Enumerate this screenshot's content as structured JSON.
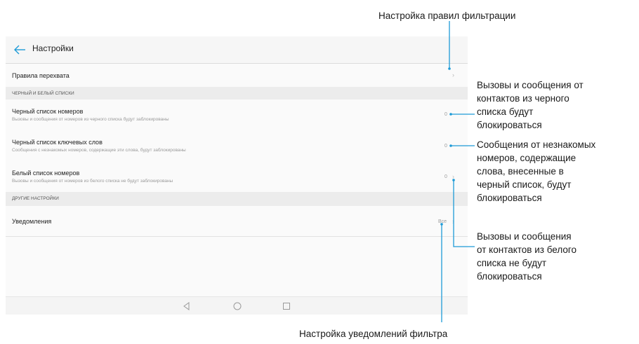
{
  "callouts": {
    "filter_rules": "Настройка правил фильтрации",
    "blacklist_numbers": [
      "Вызовы и сообщения от",
      "контактов из черного",
      "списка будут",
      "блокироваться"
    ],
    "blacklist_keywords": [
      "Сообщения от незнакомых",
      "номеров, содержащие",
      "слова, внесенные в",
      "черный список, будут",
      "блокироваться"
    ],
    "whitelist": [
      "Вызовы и сообщения",
      "от контактов из белого",
      "списка не будут",
      "блокироваться"
    ],
    "notifications": "Настройка уведомлений фильтра"
  },
  "screen": {
    "title": "Настройки",
    "back_icon": "arrow-left-icon",
    "accent_color": "#1e9bd7",
    "rows": {
      "intercept_rules": {
        "title": "Правила перехвата"
      },
      "section_lists": "Черный и белый списки",
      "blacklist_numbers": {
        "title": "Черный список номеров",
        "subtitle": "Вызовы и сообщения от номеров из черного списка будут заблокированы",
        "value": "0"
      },
      "blacklist_keywords": {
        "title": "Черный список ключевых слов",
        "subtitle": "Сообщения с незнакомых номеров, содержащие эти слова, будут заблокированы",
        "value": "0"
      },
      "whitelist_numbers": {
        "title": "Белый список номеров",
        "subtitle": "Вызовы и сообщения от номеров из белого списка не будут заблокированы",
        "value": "0"
      },
      "section_other": "Другие настройки",
      "notifications": {
        "title": "Уведомления",
        "value": "Все"
      }
    },
    "navbar": [
      "back-triangle-icon",
      "home-circle-icon",
      "recents-square-icon"
    ]
  }
}
